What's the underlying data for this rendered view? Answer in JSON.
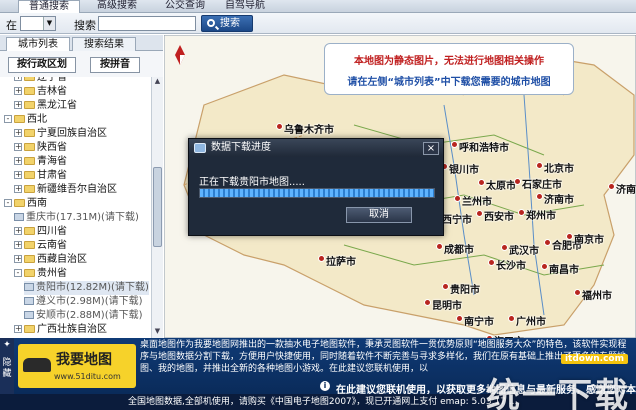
{
  "top_tabs": [
    "普通搜索",
    "高级搜索",
    "公交查询",
    "自驾导航"
  ],
  "search": {
    "scope_label": "在",
    "scope_value": "",
    "keyword_label": "搜索",
    "keyword_value": "",
    "button_label": "搜索"
  },
  "left_panel": {
    "tabs": [
      "城市列表",
      "搜索结果"
    ],
    "buttons": [
      "按行政区划",
      "按拼音"
    ],
    "tree": [
      {
        "level": 1,
        "toggle": "+",
        "icon": "folder",
        "label": "辽宁省"
      },
      {
        "level": 1,
        "toggle": "+",
        "icon": "folder",
        "label": "吉林省"
      },
      {
        "level": 1,
        "toggle": "+",
        "icon": "folder",
        "label": "黑龙江省"
      },
      {
        "level": 0,
        "toggle": "-",
        "icon": "folder",
        "label": "西北"
      },
      {
        "level": 1,
        "toggle": "+",
        "icon": "folder",
        "label": "宁夏回族自治区"
      },
      {
        "level": 1,
        "toggle": "+",
        "icon": "folder",
        "label": "陕西省"
      },
      {
        "level": 1,
        "toggle": "+",
        "icon": "folder",
        "label": "青海省"
      },
      {
        "level": 1,
        "toggle": "+",
        "icon": "folder",
        "label": "甘肃省"
      },
      {
        "level": 1,
        "toggle": "+",
        "icon": "folder",
        "label": "新疆维吾尔自治区"
      },
      {
        "level": 0,
        "toggle": "-",
        "icon": "folder",
        "label": "西南"
      },
      {
        "level": 1,
        "toggle": "",
        "icon": "map",
        "label": "重庆市(17.31M)(请下载)"
      },
      {
        "level": 1,
        "toggle": "+",
        "icon": "folder",
        "label": "四川省"
      },
      {
        "level": 1,
        "toggle": "+",
        "icon": "folder",
        "label": "云南省"
      },
      {
        "level": 1,
        "toggle": "+",
        "icon": "folder",
        "label": "西藏自治区"
      },
      {
        "level": 1,
        "toggle": "-",
        "icon": "folder",
        "label": "贵州省"
      },
      {
        "level": 2,
        "toggle": "",
        "icon": "map",
        "label": "贵阳市(12.82M)(请下载)"
      },
      {
        "level": 2,
        "toggle": "",
        "icon": "map",
        "label": "遵义市(2.98M)(请下载)"
      },
      {
        "level": 2,
        "toggle": "",
        "icon": "map",
        "label": "安顺市(2.88M)(请下载)"
      },
      {
        "level": 1,
        "toggle": "+",
        "icon": "folder",
        "label": "广西壮族自治区"
      }
    ]
  },
  "map": {
    "notice_line1": "本地图为静态图片，无法进行地图相关操作",
    "notice_line2": "请在左侧“城市列表”中下载您需要的城市地图",
    "cities": [
      "乌鲁木齐市",
      "呼和浩特市",
      "银川市",
      "北京市",
      "太原市",
      "石家庄市",
      "济南市",
      "西宁市",
      "兰州市",
      "西安市",
      "郑州市",
      "成都市",
      "武汉市",
      "合肥市",
      "南京市",
      "拉萨市",
      "长沙市",
      "南昌市",
      "贵阳市",
      "昆明市",
      "福州市",
      "南宁市",
      "广州市",
      "海口市",
      "济南市"
    ]
  },
  "dialog": {
    "title": "数据下载进度",
    "status": "正在下载贵阳市地图.....",
    "progress": 1.0,
    "cancel_label": "取消",
    "close_label": "×"
  },
  "ad": {
    "side_label": "隐藏",
    "logo_title": "我要地图",
    "logo_url": "www.51ditu.com",
    "text": "桌面地图作为我要地图网推出的一款抽水电子地图软件，秉承灵图软件一贯优势原则“地图服务大众”的特色，该软件实现程序与地图数据分割下载，方便用户快捷使用，同时随着软件不断完善与寻求多样化，我们在原有基础上推出了更多的专题地图、我的地图，并推出全新的各种地图小游戏。在此建议您联机使用，以",
    "bottom_msg": "在此建议您联机使用，以获取更多地图信息与最新服务，感谢您对本软件的支持与参与，谢谢！"
  },
  "status_bar": "全国地图数据,全部机使用，请购买《中国电子地图2007》，现已开通网上支付  emap: 5.03.17 ...",
  "watermark": {
    "site": "itdown.com",
    "text": "统一下载"
  }
}
